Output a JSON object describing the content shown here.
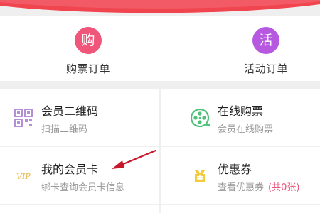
{
  "colors": {
    "banner": "#f0444f",
    "buy_icon": "#f0557a",
    "event_icon": "#b659e0",
    "qr_icon": "#b38fd6",
    "ticket_icon": "#4fc07a",
    "vip_icon": "#e9b94a",
    "coupon_icon": "#f2cc3f",
    "accent_red": "#e8577b",
    "arrow": "#c8162c"
  },
  "orders": {
    "buy": {
      "icon_text": "购",
      "label": "购票订单"
    },
    "event": {
      "icon_text": "活",
      "label": "活动订单"
    }
  },
  "menu": {
    "member_qr": {
      "icon": "qr-code-icon",
      "title": "会员二维码",
      "subtitle": "扫描二维码"
    },
    "online_ticket": {
      "icon": "film-reel-icon",
      "title": "在线购票",
      "subtitle": "会员在线购票"
    },
    "my_card": {
      "icon": "vip-card-icon",
      "icon_text": "VIP",
      "title": "我的会员卡",
      "subtitle": "绑卡查询会员卡信息"
    },
    "coupons": {
      "icon": "coupon-icon",
      "title": "优惠券",
      "subtitle": "查看优惠券",
      "count": "(共0张)"
    }
  }
}
